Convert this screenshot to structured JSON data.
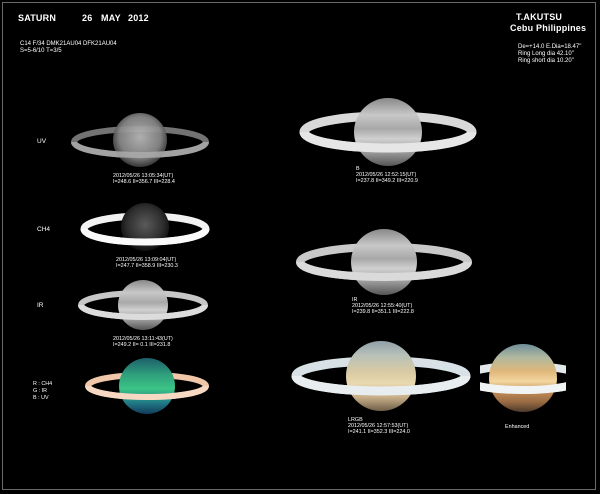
{
  "header": {
    "object": "SATURN",
    "day": "26",
    "month": "MAY",
    "year": "2012",
    "observer": "T.AKUTSU",
    "location": "Cebu  Philippines"
  },
  "equipment": {
    "line1": "C14  F/34   DMK21AU04   DFK21AU04",
    "line2": "S=5-6/10   T=3/5"
  },
  "ephemeris": {
    "line1": "De=+14.0  E.Dia=18.47\"",
    "line2": "Ring Long  dia 42.10\"",
    "line3": "Ring short dia 10.20\""
  },
  "panels": {
    "uv": {
      "label": "UV",
      "time": "2012/05/26 13:05:34(UT)",
      "cm": "I=248.6 II=356.7 III=228.4"
    },
    "ch4": {
      "label": "CH4",
      "time": "2012/05/26 13:09:04(UT)",
      "cm": "I=247.7 II=358.9 III=230.3"
    },
    "ir_left": {
      "label": "IR",
      "time": "2012/05/26 13:11:43(UT)",
      "cm": "I=249.2 II=  0.1 III=231.8"
    },
    "composite": {
      "r": "R : CH4",
      "g": "G :  IR",
      "b": "B :  UV"
    },
    "b": {
      "label": "B",
      "time": "2012/05/26 12:52:15(UT)",
      "cm": "I=237.8 II=349.2 III=220.9"
    },
    "ir_right": {
      "label": "IR",
      "time": "2012/05/26 12:55:40(UT)",
      "cm": "I=239.8 II=351.1 III=222.8"
    },
    "lrgb": {
      "label": "LRGB",
      "time": "2012/05/26 12:57:53(UT)",
      "cm": "I=241.1 II=352.3 III=224.0"
    },
    "enhanced": {
      "label": "Enhanced"
    }
  },
  "colors": {
    "background": "#000000",
    "frame": "#6a6a6a",
    "text": "#ffffff"
  }
}
